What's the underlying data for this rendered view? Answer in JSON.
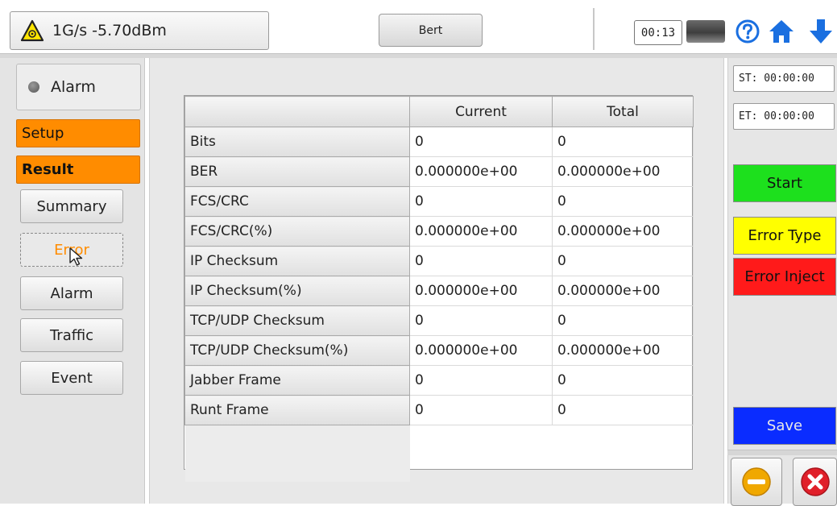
{
  "header": {
    "status_text": "1G/s -5.70dBm",
    "mode_button": "Bert",
    "timer": "00:13",
    "icons": [
      "warning-icon",
      "battery-icon",
      "help-icon",
      "home-icon",
      "arrow-down-icon"
    ]
  },
  "sidebar": {
    "alarm_label": "Alarm",
    "setup_label": "Setup",
    "result_label": "Result",
    "items": [
      {
        "label": "Summary"
      },
      {
        "label": "Error"
      },
      {
        "label": "Alarm"
      },
      {
        "label": "Traffic"
      },
      {
        "label": "Event"
      }
    ]
  },
  "table": {
    "columns": [
      "",
      "Current",
      "Total"
    ],
    "rows": [
      [
        "Bits",
        "0",
        "0"
      ],
      [
        "BER",
        "0.000000e+00",
        "0.000000e+00"
      ],
      [
        "FCS/CRC",
        "0",
        "0"
      ],
      [
        "FCS/CRC(%)",
        "0.000000e+00",
        "0.000000e+00"
      ],
      [
        "IP Checksum",
        "0",
        "0"
      ],
      [
        "IP Checksum(%)",
        "0.000000e+00",
        "0.000000e+00"
      ],
      [
        "TCP/UDP Checksum",
        "0",
        "0"
      ],
      [
        "TCP/UDP Checksum(%)",
        "0.000000e+00",
        "0.000000e+00"
      ],
      [
        "Jabber Frame",
        "0",
        "0"
      ],
      [
        "Runt Frame",
        "0",
        "0"
      ]
    ]
  },
  "right": {
    "start_time": "ST: 00:00:00",
    "end_time": "ET: 00:00:00",
    "start_button": "Start",
    "error_type_button": "Error Type",
    "error_inject_button": "Error Inject",
    "save_button": "Save"
  },
  "colors": {
    "orange": "#ff8c00",
    "green": "#1de01d",
    "yellow": "#ffff00",
    "red": "#ff1a1a",
    "blue": "#0a2cff"
  }
}
